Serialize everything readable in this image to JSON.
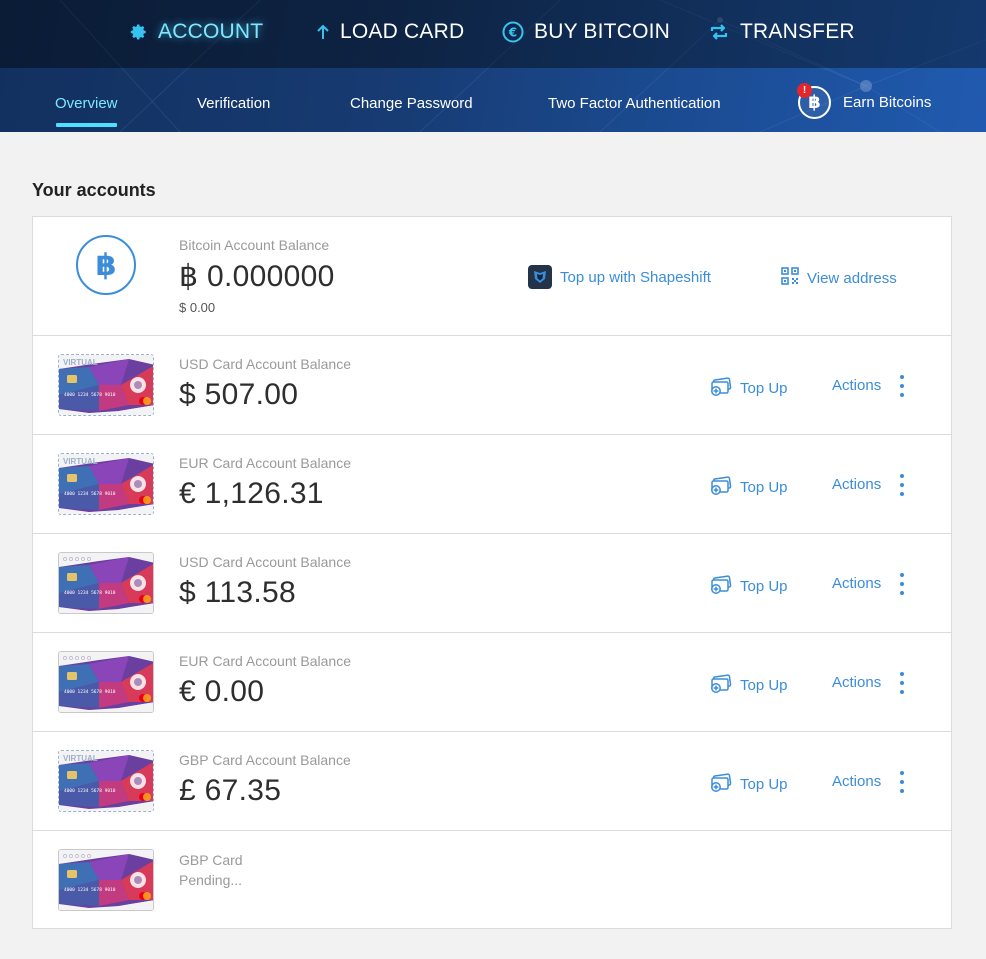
{
  "top_nav": [
    {
      "label": "ACCOUNT",
      "icon": "gear-icon",
      "active": true
    },
    {
      "label": "LOAD CARD",
      "icon": "arrow-up-icon",
      "active": false
    },
    {
      "label": "BUY BITCOIN",
      "icon": "coin-icon",
      "active": false
    },
    {
      "label": "TRANSFER",
      "icon": "transfer-icon",
      "active": false
    }
  ],
  "sub_nav": [
    {
      "label": "Overview",
      "active": true
    },
    {
      "label": "Verification",
      "active": false
    },
    {
      "label": "Change Password",
      "active": false
    },
    {
      "label": "Two Factor Authentication",
      "active": false
    }
  ],
  "earn": {
    "label": "Earn Bitcoins",
    "badge": "!",
    "coin_symbol": "฿"
  },
  "section_title": "Your accounts",
  "bitcoin_account": {
    "logo_symbol": "฿",
    "label": "Bitcoin Account Balance",
    "amount": "฿ 0.000000",
    "sub_amount": "$ 0.00",
    "topup_label": "Top up with Shapeshift",
    "view_address_label": "View address"
  },
  "card_accounts": [
    {
      "label": "USD Card Account Balance",
      "amount": "$ 507.00",
      "virtual": true,
      "virtual_text": "VIRTUAL",
      "topup_label": "Top Up",
      "actions_label": "Actions"
    },
    {
      "label": "EUR Card Account Balance",
      "amount": "€ 1,126.31",
      "virtual": true,
      "virtual_text": "VIRTUAL",
      "topup_label": "Top Up",
      "actions_label": "Actions"
    },
    {
      "label": "USD Card Account Balance",
      "amount": "$ 113.58",
      "virtual": false,
      "topup_label": "Top Up",
      "actions_label": "Actions"
    },
    {
      "label": "EUR Card Account Balance",
      "amount": "€ 0.00",
      "virtual": false,
      "topup_label": "Top Up",
      "actions_label": "Actions"
    },
    {
      "label": "GBP Card Account Balance",
      "amount": "£ 67.35",
      "virtual": true,
      "virtual_text": "VIRTUAL",
      "topup_label": "Top Up",
      "actions_label": "Actions"
    }
  ],
  "pending_card": {
    "label": "GBP Card",
    "status": "Pending..."
  },
  "card_number_text": "4000 1234 5678 9010",
  "colors": {
    "accent": "#3b8dd9",
    "active_nav": "#7ee7ff",
    "header_dark": "#0d1f3c",
    "header_blue": "#2360b8",
    "badge_red": "#e5252c"
  }
}
